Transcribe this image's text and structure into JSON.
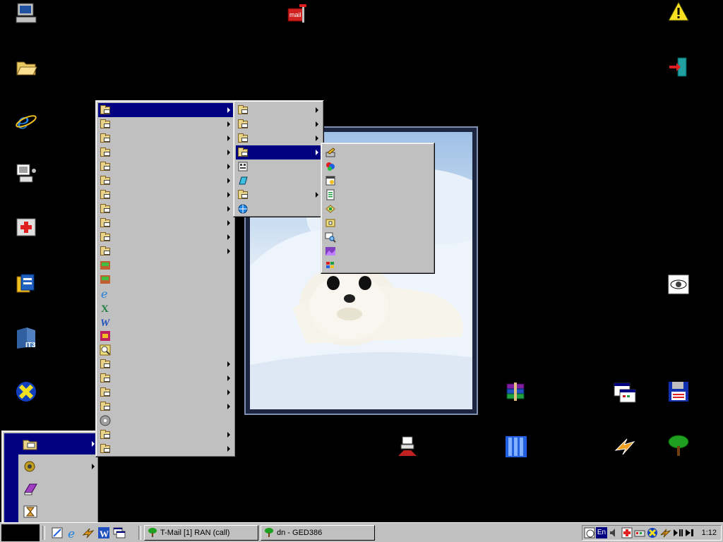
{
  "desktop": {
    "icons": [
      {
        "name": "my-computer-icon"
      },
      {
        "name": "mail-icon"
      },
      {
        "name": "warning-icon"
      },
      {
        "name": "folder-open-icon"
      },
      {
        "name": "exit-door-icon"
      },
      {
        "name": "internet-explorer-icon"
      },
      {
        "name": "network-computer-icon"
      },
      {
        "name": "first-aid-icon"
      },
      {
        "name": "archive-icon"
      },
      {
        "name": "eye-icon"
      },
      {
        "name": "it3-icon"
      },
      {
        "name": "x-close-icon"
      },
      {
        "name": "winrar-books-icon"
      },
      {
        "name": "windows-panel-icon"
      },
      {
        "name": "floppy-disk-icon"
      },
      {
        "name": "user-tool-icon"
      },
      {
        "name": "columns-icon"
      },
      {
        "name": "lightning-icon"
      },
      {
        "name": "tree-icon"
      }
    ]
  },
  "wallpaper": {
    "subject_icon": "seal-photo"
  },
  "taskbar": {
    "tasks": [
      {
        "label": "T-Mail [1] RAN (call)"
      },
      {
        "label": "dn - GED386"
      }
    ],
    "tray": {
      "lang": "En",
      "clock": "1:12"
    }
  },
  "colors": {
    "highlight": "#000080",
    "menu_bg": "#c0c0c0",
    "desktop": "#000000"
  }
}
